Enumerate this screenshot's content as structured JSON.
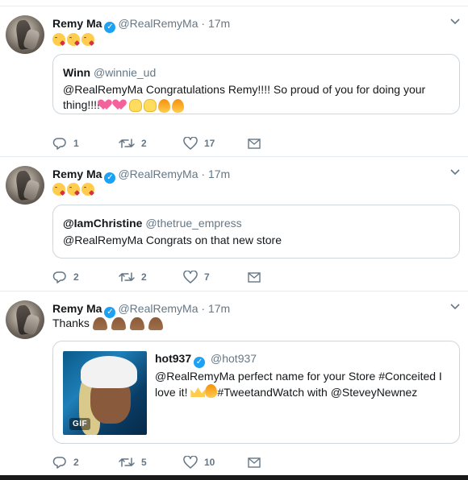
{
  "tweets": [
    {
      "author_name": "Remy Ma",
      "author_handle": "@RealRemyMa",
      "separator": "·",
      "time": "17m",
      "text": "",
      "emojis": [
        "kissing-heart",
        "kissing-heart",
        "kissing-heart"
      ],
      "quote": {
        "name": "Winn",
        "handle": "@winnie_ud",
        "text_line1": "@RealRemyMa Congratulations Remy!!!! So proud of you for doing your",
        "text_line2": "thing!!!!",
        "emojis": [
          "two-hearts",
          "two-hearts",
          "clapping-hands",
          "clapping-hands",
          "fire",
          "fire"
        ]
      },
      "actions": {
        "replies": "1",
        "retweets": "2",
        "likes": "17"
      }
    },
    {
      "author_name": "Remy Ma",
      "author_handle": "@RealRemyMa",
      "separator": "·",
      "time": "17m",
      "text": "",
      "emojis": [
        "kissing-heart",
        "kissing-heart",
        "kissing-heart"
      ],
      "quote": {
        "name": "@IamChristine",
        "handle": "@thetrue_empress",
        "text_line1": "@RealRemyMa Congrats on that new store"
      },
      "actions": {
        "replies": "2",
        "retweets": "2",
        "likes": "7"
      }
    },
    {
      "author_name": "Remy Ma",
      "author_handle": "@RealRemyMa",
      "separator": "·",
      "time": "17m",
      "text": "Thanks",
      "emojis": [
        "folded-hands",
        "folded-hands",
        "folded-hands",
        "folded-hands"
      ],
      "quote": {
        "name": "hot937",
        "handle": "@hot937",
        "text_line1": "@RealRemyMa perfect name for your Store #Conceited I",
        "text_line2a": "love it!",
        "text_line2b": "#TweetandWatch with @SteveyNewnez",
        "gif_label": "GIF"
      },
      "actions": {
        "replies": "2",
        "retweets": "5",
        "likes": "10"
      }
    }
  ],
  "colors": {
    "accent": "#1da1f2",
    "muted": "#657786",
    "text": "#14171a",
    "border": "#e6ecf0"
  }
}
